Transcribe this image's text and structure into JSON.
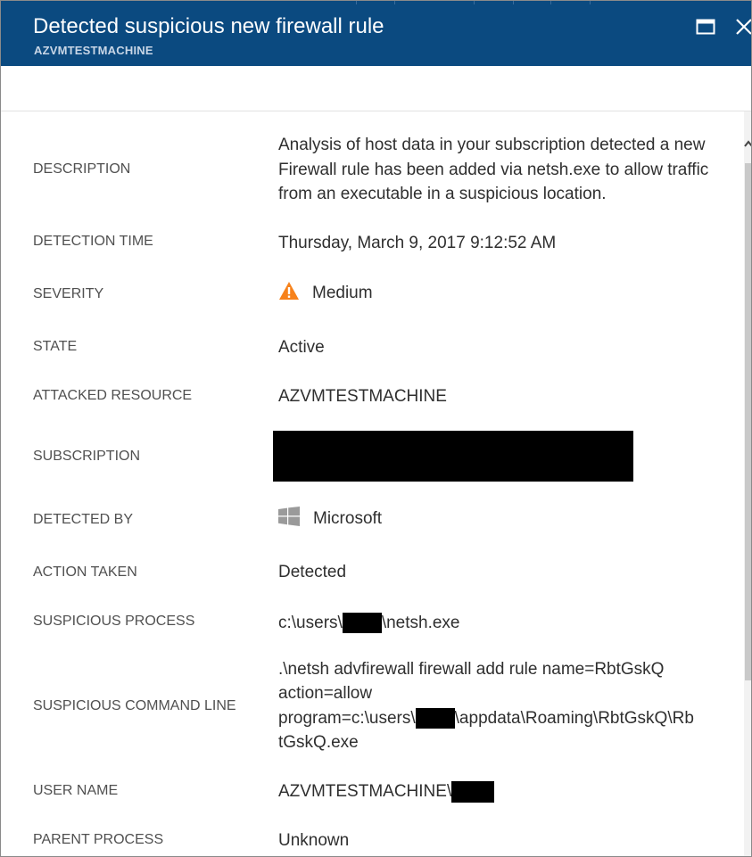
{
  "header": {
    "title": "Detected suspicious new firewall rule",
    "subtitle": "AZVMTESTMACHINE",
    "maximize_icon": "maximize-icon",
    "close_icon": "close-icon",
    "color": "#0b4a80"
  },
  "details": {
    "description": {
      "label": "DESCRIPTION",
      "value": "Analysis of host data in your subscription detected a new Firewall rule has been added via netsh.exe to allow traffic from an executable in a suspicious location."
    },
    "detection_time": {
      "label": "DETECTION TIME",
      "value": "Thursday, March 9, 2017 9:12:52 AM"
    },
    "severity": {
      "label": "SEVERITY",
      "value": "Medium",
      "icon": "warning-icon",
      "icon_color": "#f7821b"
    },
    "state": {
      "label": "STATE",
      "value": "Active"
    },
    "attacked_resource": {
      "label": "ATTACKED RESOURCE",
      "value": "AZVMTESTMACHINE"
    },
    "subscription": {
      "label": "SUBSCRIPTION",
      "value_redacted": true
    },
    "detected_by": {
      "label": "DETECTED BY",
      "value": "Microsoft",
      "icon": "windows-logo-icon"
    },
    "action_taken": {
      "label": "ACTION TAKEN",
      "value": "Detected"
    },
    "suspicious_process": {
      "label": "SUSPICIOUS PROCESS",
      "value_prefix": "c:\\users\\",
      "value_suffix": "\\netsh.exe"
    },
    "suspicious_command_line": {
      "label": "SUSPICIOUS COMMAND LINE",
      "line1": ".\\netsh  advfirewall firewall add rule name=RbtGskQ",
      "line2": "action=allow",
      "line3_prefix": "program=c:\\users\\",
      "line3_suffix": "\\appdata\\Roaming\\RbtGskQ\\Rb",
      "line4": "tGskQ.exe"
    },
    "user_name": {
      "label": "USER NAME",
      "value_prefix": "AZVMTESTMACHINE\\"
    },
    "parent_process": {
      "label": "PARENT PROCESS",
      "value": "Unknown"
    }
  }
}
